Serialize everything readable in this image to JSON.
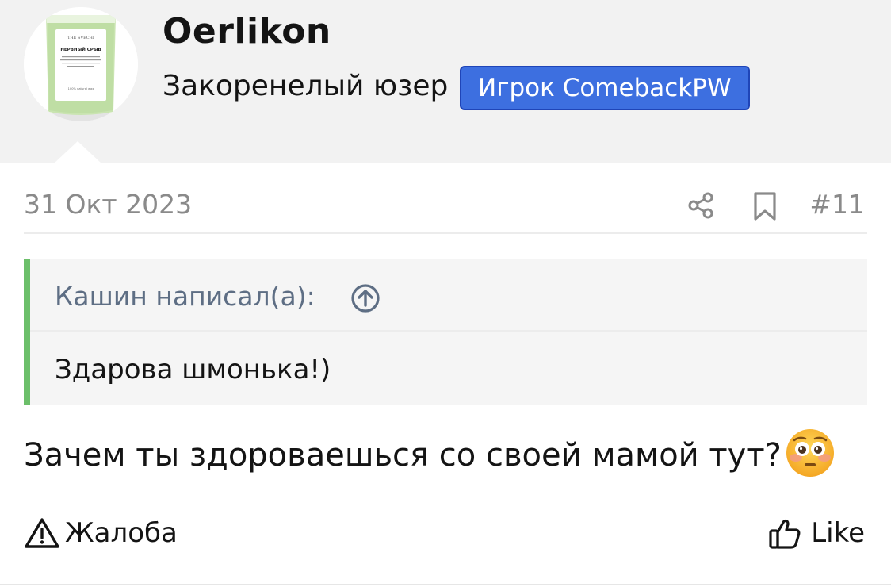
{
  "user": {
    "name": "Oerlikon",
    "title": "Закоренелый юзер",
    "banner": "Игрок ComebackPW"
  },
  "avatar": {
    "brand": "THE SVECHI",
    "product": "НЕРВНЫЙ СРЫВ",
    "note": "100% natural wax"
  },
  "post": {
    "date": "31 Окт 2023",
    "number": "#11",
    "quote": {
      "author": "Кашин написал(а):",
      "text": "Здарова шмонька!)"
    },
    "message": "Зачем ты здороваешься со своей мамой тут?",
    "emoji": "flushed-face"
  },
  "actions": {
    "report": "Жалоба",
    "like": "Like"
  },
  "colors": {
    "banner_bg": "#3d6fe0",
    "quote_accent": "#6cbf6a",
    "header_bg": "#f2f2f2",
    "muted_text": "#8a8a8a",
    "quote_author": "#5e6e84"
  }
}
